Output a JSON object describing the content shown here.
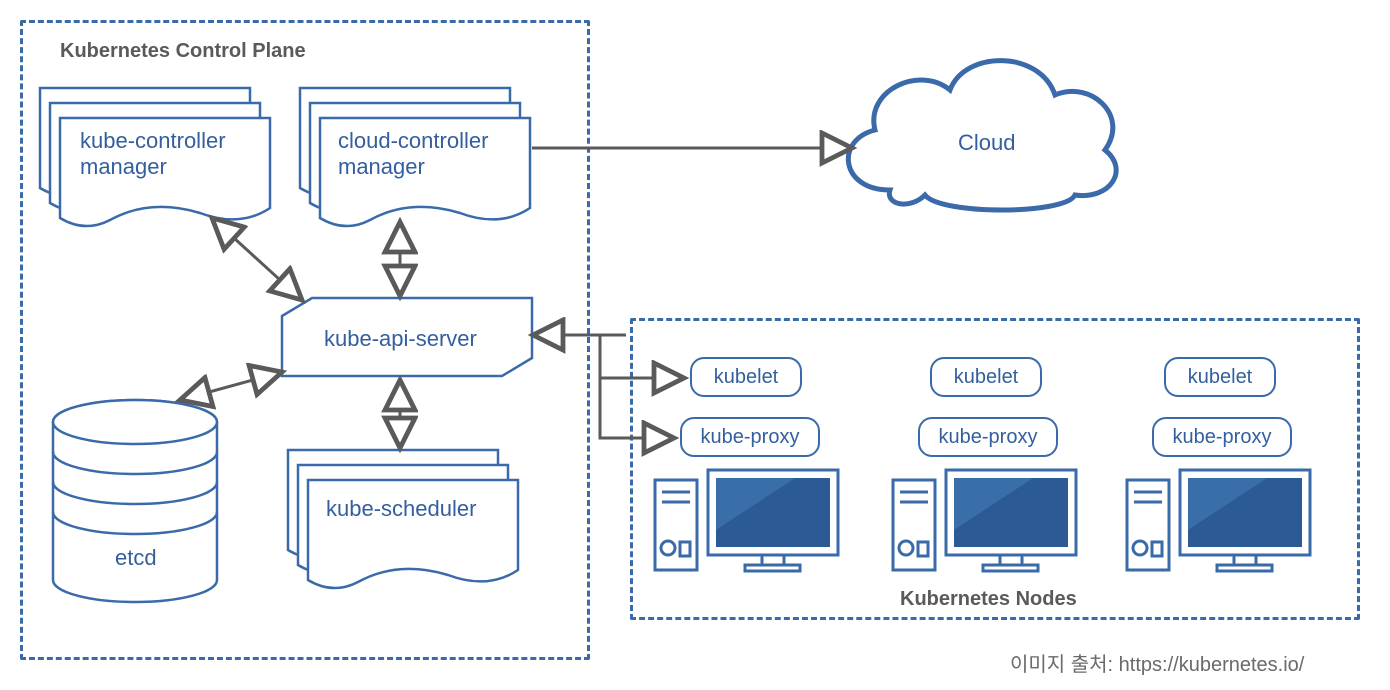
{
  "controlPlane": {
    "title": "Kubernetes Control Plane",
    "kubeControllerManager": "kube-controller\nmanager",
    "cloudControllerManager": "cloud-controller\nmanager",
    "kubeApiServer": "kube-api-server",
    "kubeScheduler": "kube-scheduler",
    "etcd": "etcd"
  },
  "nodesBox": {
    "title": "Kubernetes Nodes",
    "kubelet": "kubelet",
    "kubeProxy": "kube-proxy"
  },
  "cloud": {
    "label": "Cloud"
  },
  "attribution": "이미지 출처: https://kubernetes.io/",
  "colors": {
    "blue": "#3a6aa9",
    "darkFill": "#2b5a95",
    "gray": "#6a6a6a"
  }
}
